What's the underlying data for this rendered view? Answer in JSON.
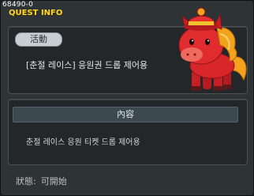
{
  "quest": {
    "id": "68490-0",
    "window_title": "QUEST INFO"
  },
  "info_panel": {
    "tag": "活動",
    "title": "[춘절 레이스] 응원권 드롭 제어용"
  },
  "description_panel": {
    "header": "內容",
    "text": "춘절 레이스 응원 티켓 드롭 제어용"
  },
  "status": {
    "label": "狀態:",
    "value": "可開始"
  },
  "npc": {
    "icon": "red-horse-mascot-icon",
    "colors": {
      "body": "#d8262b",
      "mane": "#f2a21c",
      "hat": "#e5322e"
    }
  }
}
